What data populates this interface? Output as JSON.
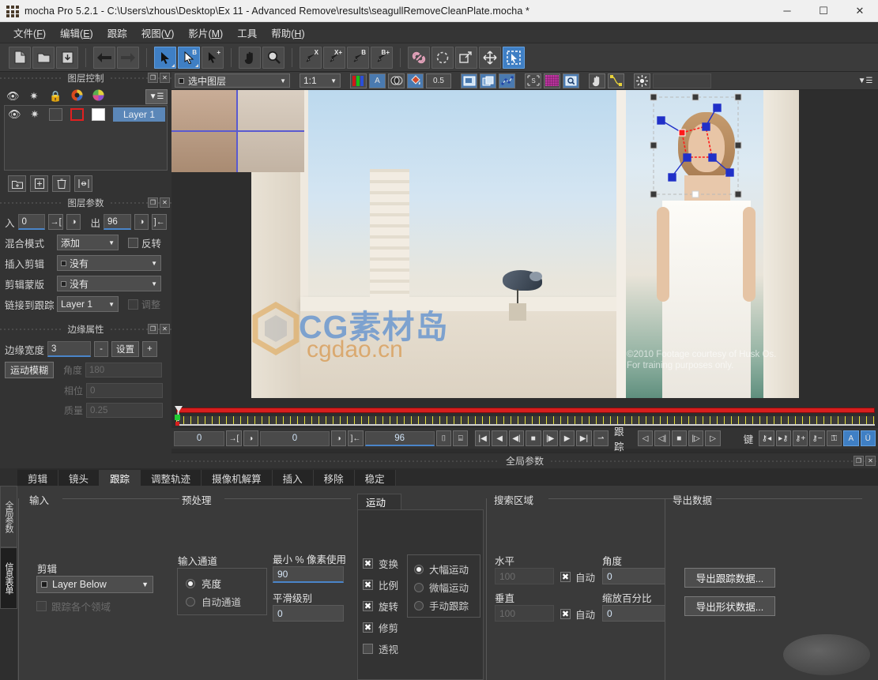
{
  "titlebar": {
    "title": "mocha Pro 5.2.1 - C:\\Users\\zhous\\Desktop\\Ex 11 - Advanced Remove\\results\\seagullRemoveCleanPlate.mocha *",
    "minimize": "─",
    "maximize": "☐",
    "close": "✕"
  },
  "menubar": {
    "items": [
      {
        "label": "文件",
        "accel": "F"
      },
      {
        "label": "编辑",
        "accel": "E"
      },
      {
        "label": "跟踪",
        "accel": ""
      },
      {
        "label": "视图",
        "accel": "V"
      },
      {
        "label": "影片",
        "accel": "M"
      },
      {
        "label": "工具",
        "accel": ""
      },
      {
        "label": "帮助",
        "accel": "H"
      }
    ]
  },
  "toolbar": {
    "groups": [
      {
        "buttons": [
          {
            "name": "new-project-icon",
            "glyph": "὜B",
            "state": "flat"
          },
          {
            "name": "open-project-icon",
            "glyph": "☐",
            "state": "flat"
          },
          {
            "name": "save-project-icon",
            "glyph": "⬇",
            "state": "flat"
          }
        ]
      },
      {
        "buttons": [
          {
            "name": "back-arrow-icon",
            "glyph": "⬅",
            "state": "flat"
          },
          {
            "name": "forward-arrow-icon",
            "glyph": "➡",
            "state": "flat"
          }
        ]
      },
      {
        "buttons": [
          {
            "name": "select-tool-icon",
            "glyph": "↖",
            "state": "selected",
            "sup": ""
          },
          {
            "name": "select-b-tool-icon",
            "glyph": "↖",
            "state": "selected",
            "sup": "B"
          },
          {
            "name": "add-point-tool-icon",
            "glyph": "↖",
            "state": "flat",
            "sup": "+"
          }
        ]
      },
      {
        "buttons": [
          {
            "name": "pan-hand-icon",
            "glyph": "✋",
            "state": "flat"
          },
          {
            "name": "zoom-magnifier-icon",
            "glyph": "ὐD",
            "state": "flat"
          }
        ]
      },
      {
        "buttons": [
          {
            "name": "xspline-pen-icon",
            "glyph": "✎",
            "state": "flat",
            "sup": "X"
          },
          {
            "name": "xspline-add-pen-icon",
            "glyph": "✎",
            "state": "flat",
            "sup": "X+"
          },
          {
            "name": "bezier-pen-icon",
            "glyph": "✎",
            "state": "flat",
            "sup": "B"
          },
          {
            "name": "bezier-add-pen-icon",
            "glyph": "✎",
            "state": "flat",
            "sup": "B+"
          }
        ]
      },
      {
        "buttons": [
          {
            "name": "link-chain-icon",
            "glyph": "ὑ7",
            "state": "flat"
          },
          {
            "name": "rotate-icon",
            "glyph": "↻",
            "state": "flat"
          },
          {
            "name": "scale-icon",
            "glyph": "⧉",
            "state": "flat"
          },
          {
            "name": "move-icon",
            "glyph": "✤",
            "state": "flat"
          },
          {
            "name": "marquee-select-icon",
            "glyph": "↖",
            "state": "selected"
          }
        ]
      }
    ]
  },
  "layer_control": {
    "title": "图层控制",
    "header_icons": [
      "eye-icon",
      "gear-icon",
      "lock-icon",
      "color-wheel-icon",
      "color-picker-icon"
    ],
    "menu_icon": "list-menu-icon",
    "rows": [
      {
        "name": "Layer 1",
        "visible": true,
        "gear": true,
        "locked": false,
        "outline_color": "#e02020",
        "fill_color": "#ffffff"
      }
    ],
    "tools": [
      {
        "name": "add-group-icon",
        "glyph": "⊞"
      },
      {
        "name": "add-layer-icon",
        "glyph": "⊞"
      },
      {
        "name": "delete-layer-icon",
        "glyph": "Ὕ1"
      },
      {
        "name": "fit-layers-icon",
        "glyph": "⤢"
      }
    ]
  },
  "layer_params": {
    "title": "图层参数",
    "in_label": "入",
    "in_value": "0",
    "out_label": "出",
    "out_value": "96",
    "blend_label": "混合模式",
    "blend_value": "添加",
    "invert_label": "反转",
    "invert_checked": false,
    "insert_clip_label": "插入剪辑",
    "insert_clip_value": "没有",
    "clip_mask_label": "剪辑蒙版",
    "clip_mask_value": "没有",
    "link_track_label": "链接到跟踪",
    "link_track_value": "Layer 1",
    "link_extra_label": "调整",
    "link_extra_checked": false
  },
  "edge_props": {
    "title": "边缘属性",
    "edge_width_label": "边缘宽度",
    "edge_width_value": "3",
    "minus": "-",
    "settings_label": "设置",
    "plus": "+",
    "motion_blur_label": "运动模糊",
    "angle_label": "角度",
    "angle_value": "180",
    "phase_label": "相位",
    "phase_value": "0",
    "quality_label": "质量",
    "quality_value": "0.25"
  },
  "viewer_toolbar": {
    "layer_select": "选中图层",
    "zoom_level": "1:1",
    "opacity_value": "0.5",
    "buttons": [
      {
        "name": "rgb-channels-icon",
        "glyph": "RGB"
      },
      {
        "name": "alpha-channel-icon",
        "glyph": "A"
      },
      {
        "name": "matte-overlay-icon",
        "glyph": "◐"
      },
      {
        "name": "paint-bucket-icon",
        "glyph": "Ὕ1"
      },
      {
        "name": "surface-overlay-icon",
        "glyph": "▣"
      },
      {
        "name": "grid-overlay-icon",
        "glyph": "⧉"
      },
      {
        "name": "track-points-icon",
        "glyph": "∴"
      },
      {
        "name": "stabilize-icon",
        "glyph": "S"
      },
      {
        "name": "mesh-grid-icon",
        "glyph": "▦"
      },
      {
        "name": "zoom-window-icon",
        "glyph": "ὐE"
      },
      {
        "name": "hand-overlay-icon",
        "glyph": "✋"
      },
      {
        "name": "spline-path-icon",
        "glyph": "∿"
      },
      {
        "name": "brightness-icon",
        "glyph": "☀"
      }
    ],
    "panel_menu_icon": "panel-menu-icon"
  },
  "viewer": {
    "watermark_main": "CG素材岛",
    "watermark_sub": "cgdao.cn",
    "copyright_line1": "©2010 Footage courtesy of Husk Os.",
    "copyright_line2": "For training purposes only."
  },
  "transport": {
    "in_value": "0",
    "mid_value": "0",
    "out_value": "96",
    "track_label": "跟踪",
    "key_label": "键",
    "playback_buttons": [
      {
        "name": "go-to-start-icon",
        "glyph": "⏮"
      },
      {
        "name": "play-backward-icon",
        "glyph": "◀"
      },
      {
        "name": "step-back-icon",
        "glyph": "◁"
      },
      {
        "name": "stop-icon",
        "glyph": "■"
      },
      {
        "name": "step-forward-icon",
        "glyph": "▷"
      },
      {
        "name": "play-forward-icon",
        "glyph": "▶"
      },
      {
        "name": "go-to-end-icon",
        "glyph": "⏭"
      },
      {
        "name": "loop-icon",
        "glyph": "⇄"
      }
    ],
    "track_buttons": [
      {
        "name": "track-backward-all-icon",
        "glyph": "◁"
      },
      {
        "name": "track-backward-icon",
        "glyph": "◁"
      },
      {
        "name": "track-stop-icon",
        "glyph": "■"
      },
      {
        "name": "track-forward-icon",
        "glyph": "▷"
      },
      {
        "name": "track-forward-all-icon",
        "glyph": "▷"
      }
    ],
    "key_buttons": [
      {
        "name": "prev-key-icon",
        "glyph": "⚷"
      },
      {
        "name": "next-key-icon",
        "glyph": "⚷"
      },
      {
        "name": "add-key-icon",
        "glyph": "⚷"
      },
      {
        "name": "delete-key-icon",
        "glyph": "⚷"
      },
      {
        "name": "delete-all-keys-icon",
        "glyph": "⚷"
      },
      {
        "name": "auto-key-icon",
        "glyph": "A"
      },
      {
        "name": "undo-key-icon",
        "glyph": "Ü"
      }
    ],
    "frame_fit_icons": [
      {
        "name": "fit-in-icon",
        "glyph": "⌶"
      },
      {
        "name": "fit-out-icon",
        "glyph": "⌷"
      }
    ]
  },
  "status": {
    "title": "全局参数"
  },
  "bottom": {
    "vertical_tabs": [
      {
        "label": "全局参数",
        "active": false
      },
      {
        "label": "信息表单",
        "active": true
      }
    ],
    "tabs": [
      {
        "label": "剪辑",
        "active": false
      },
      {
        "label": "镜头",
        "active": false
      },
      {
        "label": "跟踪",
        "active": true
      },
      {
        "label": "调整轨迹",
        "active": false
      },
      {
        "label": "摄像机解算",
        "active": false
      },
      {
        "label": "插入",
        "active": false
      },
      {
        "label": "移除",
        "active": false
      },
      {
        "label": "稳定",
        "active": false
      }
    ],
    "input_group": {
      "title": "输入",
      "clip_label": "剪辑",
      "clip_value": "Layer Below",
      "track_each_field_label": "跟踪各个领域",
      "track_each_field_checked": false
    },
    "preprocess_group": {
      "title": "预处理",
      "input_channel_label": "输入通道",
      "channel_options": [
        {
          "label": "亮度",
          "selected": true
        },
        {
          "label": "自动通道",
          "selected": false
        }
      ],
      "min_pixel_label": "最小 % 像素使用",
      "min_pixel_value": "90",
      "smooth_level_label": "平滑级别",
      "smooth_level_value": "0"
    },
    "motion_group": {
      "tab_label": "运动",
      "checks": [
        {
          "label": "变换",
          "checked": true
        },
        {
          "label": "比例",
          "checked": true
        },
        {
          "label": "旋转",
          "checked": true
        },
        {
          "label": "修剪",
          "checked": true
        },
        {
          "label": "透视",
          "checked": false
        }
      ],
      "radios": [
        {
          "label": "大幅运动",
          "selected": true
        },
        {
          "label": "微幅运动",
          "selected": false
        },
        {
          "label": "手动跟踪",
          "selected": false
        }
      ]
    },
    "search_group": {
      "title": "搜索区域",
      "horizontal_label": "水平",
      "horizontal_value": "100",
      "horizontal_auto_label": "自动",
      "horizontal_auto_checked": true,
      "vertical_label": "垂直",
      "vertical_value": "100",
      "vertical_auto_label": "自动",
      "vertical_auto_checked": true,
      "angle_label": "角度",
      "angle_value": "0",
      "scale_percent_label": "缩放百分比",
      "scale_percent_value": "0"
    },
    "export_group": {
      "title": "导出数据",
      "export_track_label": "导出跟踪数据...",
      "export_shape_label": "导出形状数据..."
    }
  }
}
